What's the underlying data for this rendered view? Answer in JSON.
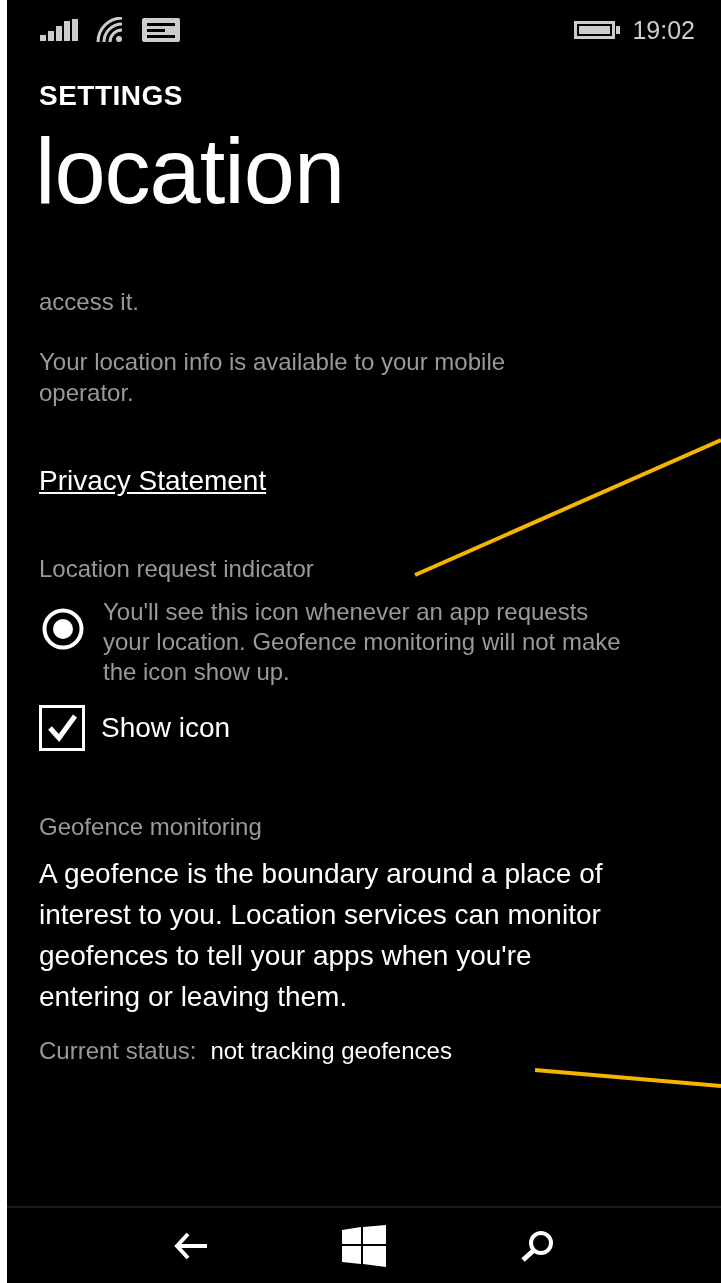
{
  "status_bar": {
    "time": "19:02"
  },
  "header": {
    "section": "SETTINGS",
    "title": "location"
  },
  "intro": {
    "tail": "access it."
  },
  "operator_note": "Your location info is available to your mobile operator.",
  "privacy_link": "Privacy Statement",
  "indicator": {
    "heading": "Location request indicator",
    "description": "You'll see this icon whenever an app requests your location. Geofence monitoring will not make the icon show up.",
    "checkbox": {
      "label": "Show icon",
      "checked": true
    }
  },
  "geofence": {
    "heading": "Geofence monitoring",
    "description": "A geofence is the boundary around a place of interest to you. Location services can monitor geofences to tell your apps when you're entering or leaving them.",
    "status_label": "Current status:",
    "status_value": "not tracking geofences"
  }
}
